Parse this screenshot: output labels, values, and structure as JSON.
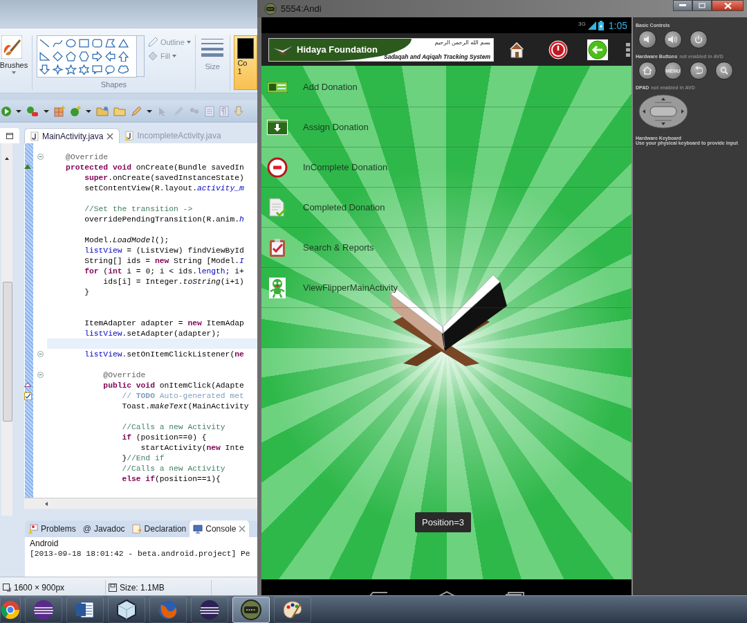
{
  "paint": {
    "ribbon": {
      "brushes": "Brushes",
      "shapes_group": "Shapes",
      "outline": "Outline",
      "fill": "Fill",
      "size": "Size",
      "color_label": "Co",
      "color_index": "1"
    },
    "status_bar": {
      "dimensions": "1600 × 900px",
      "file_size": "Size: 1.1MB"
    }
  },
  "eclipse": {
    "editor_tabs": [
      {
        "label": "MainActivity.java",
        "selected": true
      },
      {
        "label": "IncompleteActivity.java",
        "selected": false
      }
    ],
    "code_lines": [
      {
        "fold": true,
        "current": false,
        "tokens": [
          {
            "kind": "an",
            "text": "    @Override"
          }
        ]
      },
      {
        "fold": false,
        "current": false,
        "kind": "override",
        "tokens": [
          {
            "kind": "kw",
            "text": "    protected void "
          },
          {
            "kind": "p",
            "text": "onCreate(Bundle savedIn"
          }
        ]
      },
      {
        "fold": false,
        "current": false,
        "tokens": [
          {
            "kind": "kw",
            "text": "        super"
          },
          {
            "kind": "p",
            "text": ".onCreate(savedInstanceState)"
          }
        ]
      },
      {
        "fold": false,
        "current": false,
        "tokens": [
          {
            "kind": "p",
            "text": "        setContentView(R.layout."
          },
          {
            "kind": "itf",
            "text": "activity_m"
          }
        ]
      },
      {
        "fold": false,
        "current": false
      },
      {
        "fold": false,
        "current": false,
        "tokens": [
          {
            "kind": "cm",
            "text": "        //Set the transition ->"
          }
        ]
      },
      {
        "fold": false,
        "current": false,
        "tokens": [
          {
            "kind": "p",
            "text": "        overridePendingTransition(R.anim."
          },
          {
            "kind": "itf",
            "text": "h"
          }
        ]
      },
      {
        "fold": false,
        "current": false
      },
      {
        "fold": false,
        "current": false,
        "tokens": [
          {
            "kind": "p",
            "text": "        Model."
          },
          {
            "kind": "it",
            "text": "LoadModel"
          },
          {
            "kind": "p",
            "text": "();"
          }
        ]
      },
      {
        "fold": false,
        "current": false,
        "tokens": [
          {
            "kind": "fld",
            "text": "        listView"
          },
          {
            "kind": "p",
            "text": " = (ListView) findViewById"
          }
        ]
      },
      {
        "fold": false,
        "current": false,
        "tokens": [
          {
            "kind": "p",
            "text": "        String[] ids = "
          },
          {
            "kind": "kw",
            "text": "new"
          },
          {
            "kind": "p",
            "text": " String [Model."
          },
          {
            "kind": "itf",
            "text": "I"
          }
        ]
      },
      {
        "fold": false,
        "current": false,
        "tokens": [
          {
            "kind": "kw",
            "text": "        for"
          },
          {
            "kind": "p",
            "text": " ("
          },
          {
            "kind": "kw",
            "text": "int"
          },
          {
            "kind": "p",
            "text": " i = 0; i < ids."
          },
          {
            "kind": "fld",
            "text": "length"
          },
          {
            "kind": "p",
            "text": "; i+"
          }
        ]
      },
      {
        "fold": false,
        "current": false,
        "tokens": [
          {
            "kind": "p",
            "text": "            ids[i] = Integer."
          },
          {
            "kind": "it",
            "text": "toString"
          },
          {
            "kind": "p",
            "text": "(i+1)"
          }
        ]
      },
      {
        "fold": false,
        "current": false,
        "tokens": [
          {
            "kind": "p",
            "text": "        }"
          }
        ]
      },
      {
        "fold": false,
        "current": false
      },
      {
        "fold": false,
        "current": false
      },
      {
        "fold": false,
        "current": false,
        "tokens": [
          {
            "kind": "p",
            "text": "        ItemAdapter adapter = "
          },
          {
            "kind": "kw",
            "text": "new"
          },
          {
            "kind": "p",
            "text": " ItemAdap"
          }
        ]
      },
      {
        "fold": false,
        "current": false,
        "tokens": [
          {
            "kind": "fld",
            "text": "        listView"
          },
          {
            "kind": "p",
            "text": ".setAdapter(adapter);"
          }
        ]
      },
      {
        "fold": false,
        "current": true
      },
      {
        "fold": true,
        "current": false,
        "tokens": [
          {
            "kind": "fld",
            "text": "        listView"
          },
          {
            "kind": "p",
            "text": ".setOnItemClickListener("
          },
          {
            "kind": "kw",
            "text": "ne"
          }
        ]
      },
      {
        "fold": false,
        "current": false
      },
      {
        "fold": true,
        "current": false,
        "tokens": [
          {
            "kind": "an",
            "text": "            @Override"
          }
        ]
      },
      {
        "fold": false,
        "current": false,
        "kind": "implements",
        "tokens": [
          {
            "kind": "kw",
            "text": "            public void "
          },
          {
            "kind": "p",
            "text": "onItemClick(Adapte"
          }
        ]
      },
      {
        "fold": false,
        "current": false,
        "kind": "task",
        "tokens": [
          {
            "kind": "task",
            "text": "                // "
          },
          {
            "kind": "todo",
            "text": "TODO"
          },
          {
            "kind": "task",
            "text": " Auto-generated met"
          }
        ]
      },
      {
        "fold": false,
        "current": false,
        "tokens": [
          {
            "kind": "p",
            "text": "                Toast."
          },
          {
            "kind": "it",
            "text": "makeText"
          },
          {
            "kind": "p",
            "text": "(MainActivity"
          }
        ]
      },
      {
        "fold": false,
        "current": false
      },
      {
        "fold": false,
        "current": false,
        "tokens": [
          {
            "kind": "cm",
            "text": "                //Calls a new Activity"
          }
        ]
      },
      {
        "fold": false,
        "current": false,
        "tokens": [
          {
            "kind": "kw",
            "text": "                if"
          },
          {
            "kind": "p",
            "text": " (position==0) {"
          }
        ]
      },
      {
        "fold": false,
        "current": false,
        "tokens": [
          {
            "kind": "p",
            "text": "                    startActivity("
          },
          {
            "kind": "kw",
            "text": "new"
          },
          {
            "kind": "p",
            "text": " Inte"
          }
        ]
      },
      {
        "fold": false,
        "current": false,
        "tokens": [
          {
            "kind": "p",
            "text": "                }"
          },
          {
            "kind": "cm",
            "text": "//End if"
          }
        ]
      },
      {
        "fold": false,
        "current": false,
        "tokens": [
          {
            "kind": "cm",
            "text": "                //Calls a new Activity"
          }
        ]
      },
      {
        "fold": false,
        "current": false,
        "tokens": [
          {
            "kind": "kw",
            "text": "                else if"
          },
          {
            "kind": "p",
            "text": "(position==1){"
          }
        ]
      }
    ],
    "panel_tabs": [
      {
        "label": "Problems",
        "kind": "problems",
        "selected": false
      },
      {
        "label": "Javadoc",
        "kind": "javadoc",
        "icon_text": "@",
        "selected": false
      },
      {
        "label": "Declaration",
        "kind": "declaration",
        "selected": false
      },
      {
        "label": "Console",
        "kind": "console",
        "selected": true
      }
    ],
    "console": {
      "title": "Android",
      "lines": [
        "[2013-09-18 18:01:42 - beta.android.project] Pe"
      ]
    }
  },
  "emulator": {
    "title": "5554:Andi",
    "status_bar": {
      "network": "3G",
      "time": "1:05"
    },
    "app_bar": {
      "title": "Hidaya Foundation",
      "arabic": "بسم الله الرحمن الرحيم",
      "tagline": "Sadaqah and Aqiqah Tracking System"
    },
    "menu_items": [
      {
        "label": "Add Donation",
        "kind": "add"
      },
      {
        "label": "Assign Donation",
        "kind": "assign"
      },
      {
        "label": "InComplete Donation",
        "kind": "incomplete"
      },
      {
        "label": "Completed Donation",
        "kind": "completed"
      },
      {
        "label": "Search & Reports",
        "kind": "reports"
      },
      {
        "label": "ViewFlipperMainActivity",
        "kind": "flipper"
      }
    ],
    "toast": "Position=3",
    "controls": {
      "basic_controls": "Basic Controls",
      "hardware_buttons": "Hardware Buttons",
      "hardware_note": "not enabled in AVD",
      "menu_key": "MENU",
      "dpad": "DPAD",
      "dpad_note": "not enabled in AVD",
      "keyboard_title": "Hardware Keyboard",
      "keyboard_note": "Use your physical keyboard to provide input"
    }
  },
  "taskbar": {
    "apps": [
      {
        "kind": "chrome",
        "selected": false
      },
      {
        "kind": "eclipse-purple",
        "selected": false
      },
      {
        "kind": "word",
        "selected": false
      },
      {
        "kind": "cube",
        "selected": false
      },
      {
        "kind": "firefox",
        "selected": false
      },
      {
        "kind": "eclipse",
        "selected": false
      },
      {
        "kind": "emulator",
        "selected": true
      },
      {
        "kind": "paint",
        "selected": false
      }
    ]
  }
}
